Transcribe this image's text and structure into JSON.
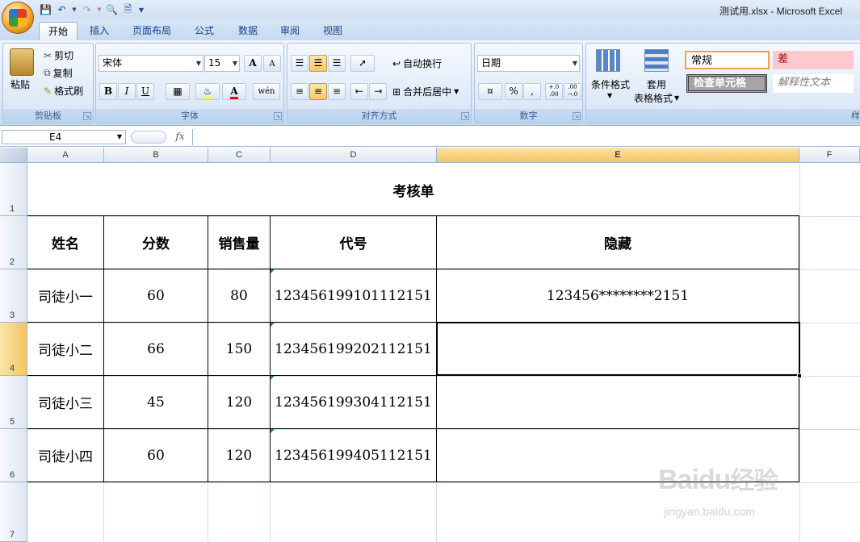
{
  "window": {
    "title": "测试用.xlsx - Microsoft Excel"
  },
  "tabs": [
    "开始",
    "插入",
    "页面布局",
    "公式",
    "数据",
    "审阅",
    "视图"
  ],
  "ribbon": {
    "clipboard": {
      "label": "剪贴板",
      "paste": "粘贴",
      "cut": "剪切",
      "copy": "复制",
      "format_painter": "格式刷"
    },
    "font": {
      "label": "字体",
      "font_name": "宋体",
      "font_size": "15",
      "bold": "B",
      "italic": "I",
      "underline": "U",
      "grow": "A",
      "shrink": "A",
      "font_color_letter": "A",
      "phonetic": "wén"
    },
    "alignment": {
      "label": "对齐方式",
      "wrap_text": "自动换行",
      "merge_center": "合并后居中"
    },
    "number": {
      "label": "数字",
      "format": "日期",
      "percent": "%",
      "comma": ",",
      "increase_decimal": "+.0 .00",
      "decrease_decimal": ".00 →.0"
    },
    "styles": {
      "label": "样",
      "conditional": "条件格式",
      "table_format_line1": "套用",
      "table_format_line2": "表格格式",
      "normal": "常规",
      "bad": "差",
      "check_cell": "检查单元格",
      "explanatory": "解释性文本"
    }
  },
  "formula_bar": {
    "name_box": "E4",
    "fx": "fx",
    "content": ""
  },
  "sheet": {
    "columns": [
      "A",
      "B",
      "C",
      "D",
      "E",
      "F"
    ],
    "rows": [
      "1",
      "2",
      "3",
      "4",
      "5",
      "6",
      "7"
    ],
    "title": "考核单",
    "headers": [
      "姓名",
      "分数",
      "销售量",
      "代号",
      "隐藏"
    ],
    "data": [
      [
        "司徒小一",
        "60",
        "80",
        "123456199101112151",
        "123456********2151"
      ],
      [
        "司徒小二",
        "66",
        "150",
        "123456199202112151",
        ""
      ],
      [
        "司徒小三",
        "45",
        "120",
        "123456199304112151",
        ""
      ],
      [
        "司徒小四",
        "60",
        "120",
        "123456199405112151",
        ""
      ]
    ],
    "selected_cell": "E4"
  },
  "watermark": {
    "brand": "Baidu",
    "brand_cn": "经验",
    "url": "jingyan.baidu.com"
  }
}
